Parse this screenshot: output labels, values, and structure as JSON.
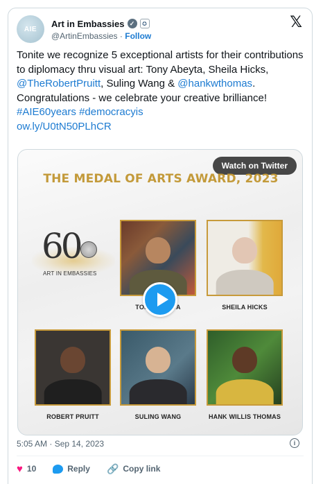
{
  "author": {
    "avatar_text": "AIE",
    "name": "Art in Embassies",
    "handle": "@ArtinEmbassies",
    "separator": "·",
    "follow_label": "Follow"
  },
  "tweet": {
    "segments": {
      "s1": "Tonite we recognize 5 exceptional artists for their contributions to diplomacy thru visual art: Tony Abeyta, Sheila Hicks, ",
      "m1": "@TheRobertPruitt",
      "s2": ", Suling Wang & ",
      "m2": "@hankwthomas",
      "s3": ".",
      "s4": "Congratulations  - we celebrate your creative brilliance!",
      "h1": "#AIE60years",
      "h2": "#democracyis",
      "url": "ow.ly/U0tN50PLhCR"
    }
  },
  "media": {
    "watch_label": "Watch on Twitter",
    "award_title": "THE MEDAL OF ARTS AWARD, 2023",
    "logo_number": "60",
    "logo_sub": "ART IN EMBASSIES",
    "captions": {
      "c1": "TONY ABEYTA",
      "c2": "SHEILA HICKS",
      "c3": "ROBERT PRUITT",
      "c4": "SULING WANG",
      "c5": "HANK WILLIS THOMAS"
    }
  },
  "footer": {
    "timestamp": "5:05 AM · Sep 14, 2023",
    "like_count": "10",
    "reply_label": "Reply",
    "copy_label": "Copy link"
  },
  "colors": {
    "link": "#1d7bd1",
    "gold": "#c39a3a",
    "like": "#f91880"
  }
}
